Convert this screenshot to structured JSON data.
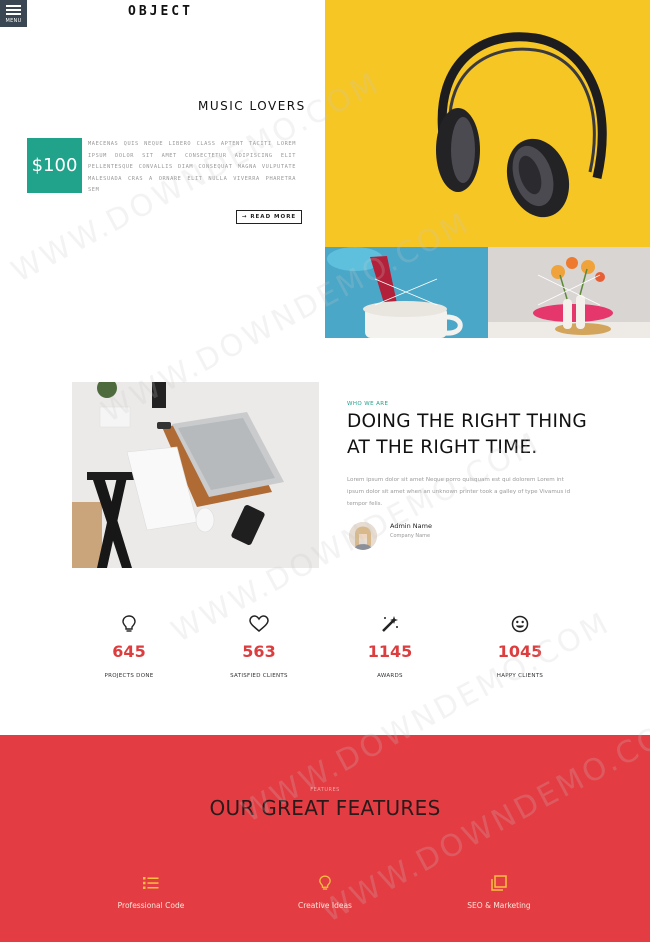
{
  "menu": {
    "label": "MENU",
    "icon": "hamburger-icon"
  },
  "logo": "OBJECT",
  "hero": {
    "title": "MUSIC LOVERS",
    "price": "$100",
    "text": "MAECENAS QUIS NEQUE LIBERO CLASS APTENT TACITI LOREM IPSUM DOLOR SIT AMET CONSECTETUR ADIPISCING ELIT PELLENTESQUE CONVALLIS DIAM CONSEQUAT MAGNA VULPUTATE MALESUADA CRAS A ORNARE ELIT NULLA VIVERRA PHARETRA SEM",
    "read_more": "→ READ MORE"
  },
  "about": {
    "label": "WHO WE ARE",
    "title": "DOING THE RIGHT THING AT THE RIGHT TIME.",
    "text": "Lorem ipsum dolor sit amet Neque porro quisquam est qui dolorem Lorem int ipsum dolor sit amet when an unknown printer took a galley of type Vivamus id tempor felis.",
    "admin_name": "Admin Name",
    "company_name": "Company Name"
  },
  "stats": [
    {
      "icon": "lightbulb-icon",
      "value": "645",
      "label": "PROJECTS DONE"
    },
    {
      "icon": "heart-icon",
      "value": "563",
      "label": "SATISFIED CLIENTS"
    },
    {
      "icon": "magic-wand-icon",
      "value": "1145",
      "label": "AWARDS"
    },
    {
      "icon": "smiley-icon",
      "value": "1045",
      "label": "HAPPY CLIENTS"
    }
  ],
  "features": {
    "subtitle": "FEATURES",
    "title": "OUR GREAT FEATURES",
    "items": [
      {
        "icon": "list-icon",
        "label": "Professional Code"
      },
      {
        "icon": "lightbulb-icon",
        "label": "Creative Ideas"
      },
      {
        "icon": "copy-icon",
        "label": "SEO & Marketing"
      }
    ]
  },
  "colors": {
    "accent_green": "#21a28a",
    "accent_red": "#e33d43",
    "stat_red": "#dc3d3e",
    "yellow": "#f6c624"
  },
  "watermark": "WWW.DOWNDEMO.COM"
}
